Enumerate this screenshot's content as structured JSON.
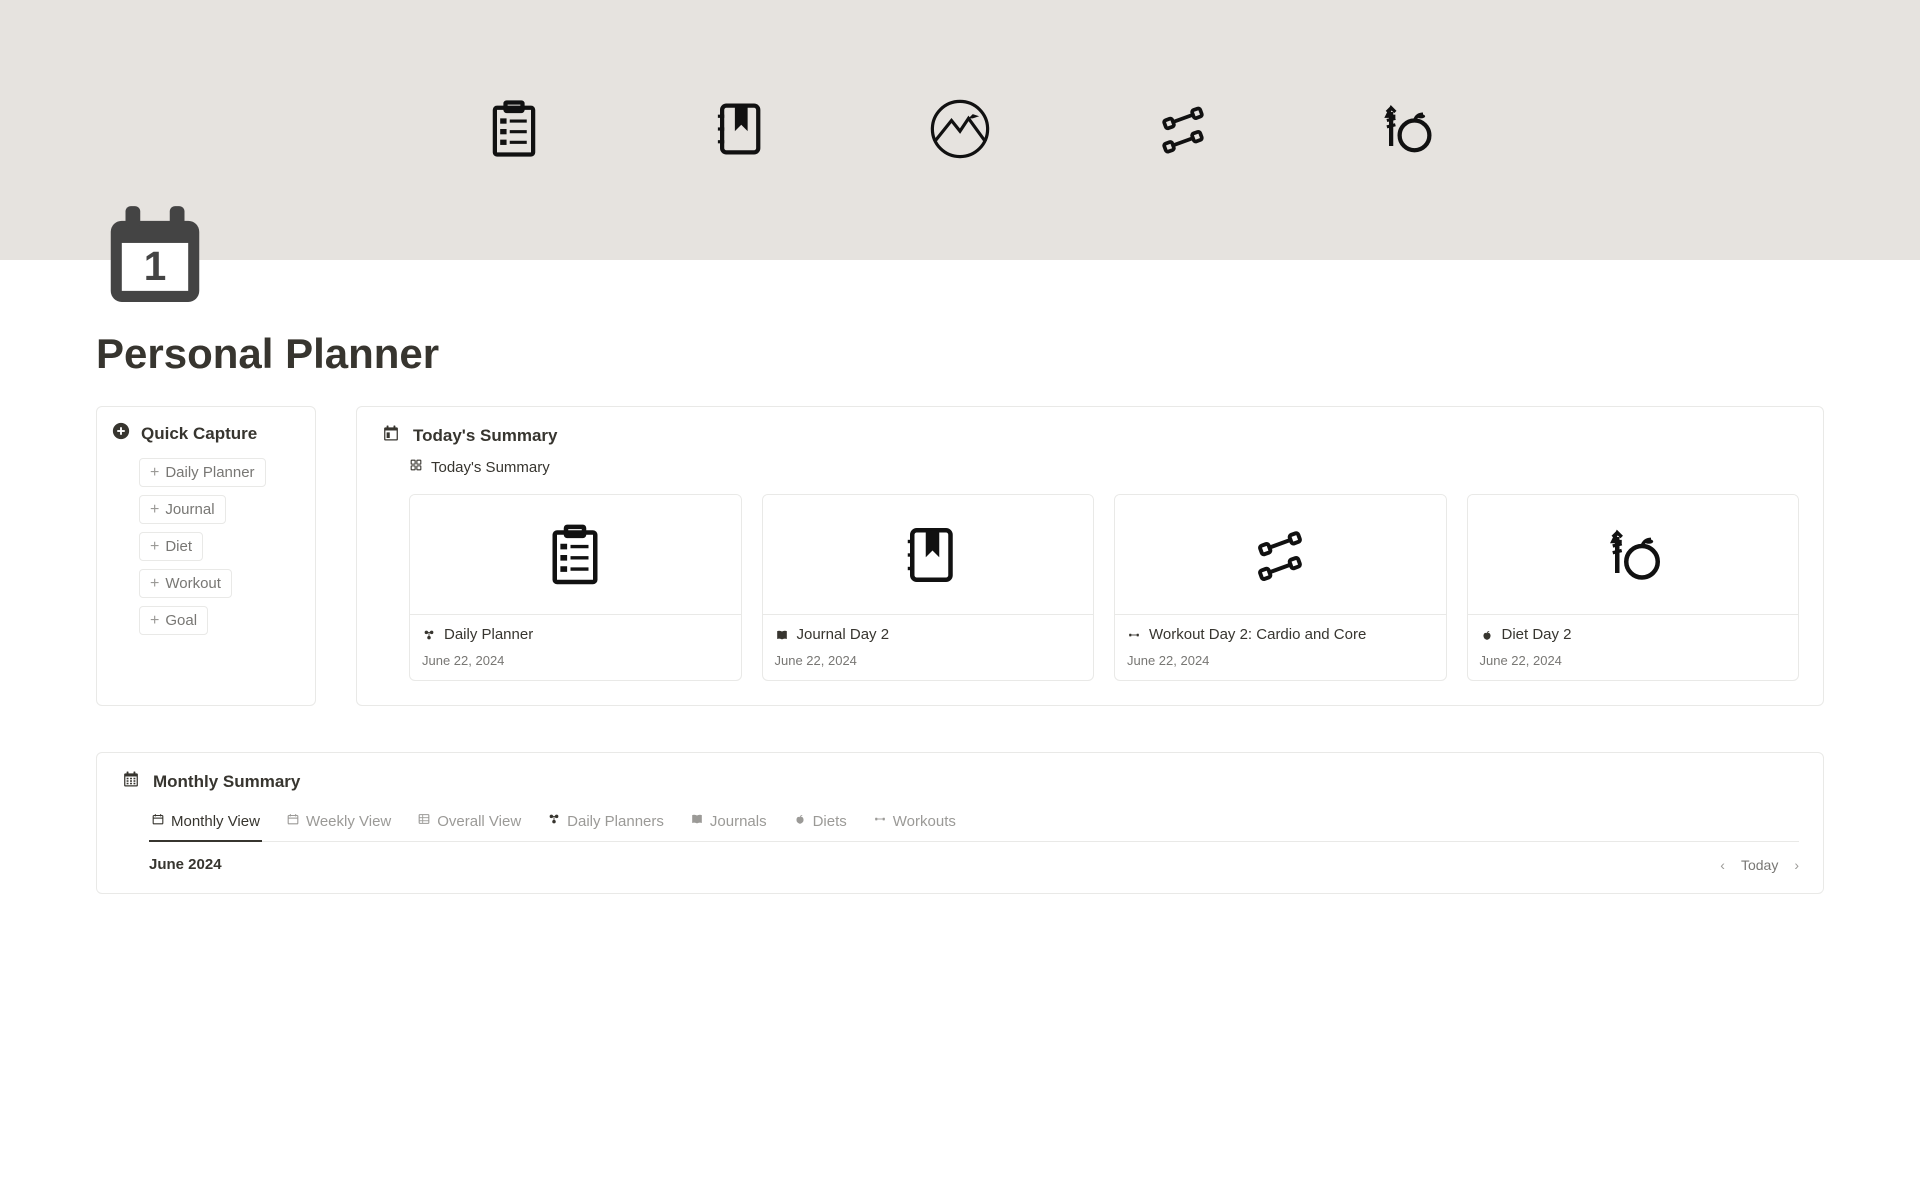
{
  "page": {
    "title": "Personal Planner"
  },
  "quick_capture": {
    "title": "Quick Capture",
    "items": [
      "Daily Planner",
      "Journal",
      "Diet",
      "Workout",
      "Goal"
    ]
  },
  "today_summary": {
    "title": "Today's Summary",
    "subtitle": "Today's Summary",
    "cards": [
      {
        "title": "Daily Planner",
        "date": "June 22, 2024",
        "icon": "planner"
      },
      {
        "title": "Journal Day 2",
        "date": "June 22, 2024",
        "icon": "journal"
      },
      {
        "title": "Workout Day 2: Cardio and Core",
        "date": "June 22, 2024",
        "icon": "workout"
      },
      {
        "title": "Diet Day 2",
        "date": "June 22, 2024",
        "icon": "diet"
      }
    ]
  },
  "monthly_summary": {
    "title": "Monthly Summary",
    "tabs": [
      "Monthly View",
      "Weekly View",
      "Overall View",
      "Daily Planners",
      "Journals",
      "Diets",
      "Workouts"
    ],
    "month": "June 2024",
    "today_label": "Today"
  }
}
